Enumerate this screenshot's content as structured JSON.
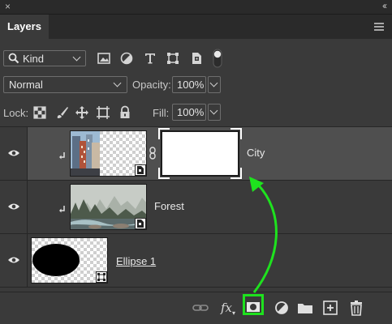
{
  "window": {
    "close_glyph": "×",
    "collapse_glyph": "‹‹"
  },
  "panel": {
    "tab_label": "Layers",
    "menu_icon": "panel-menu-icon"
  },
  "filter": {
    "kind_label": "Kind",
    "icons": [
      "image-filter-icon",
      "adjustment-filter-icon",
      "type-filter-icon",
      "shape-filter-icon",
      "smart-object-filter-icon",
      "filter-toggle-icon"
    ]
  },
  "blend": {
    "mode": "Normal",
    "opacity_label": "Opacity:",
    "opacity_value": "100%"
  },
  "lock": {
    "label": "Lock:",
    "icons": [
      "lock-transparent-pixels-icon",
      "lock-image-pixels-icon",
      "lock-position-icon",
      "lock-artboard-icon",
      "lock-all-icon"
    ],
    "fill_label": "Fill:",
    "fill_value": "100%"
  },
  "layers": [
    {
      "name": "City",
      "selected": true,
      "clipped": true,
      "has_mask": true,
      "type": "smart-object"
    },
    {
      "name": "Forest",
      "selected": false,
      "clipped": true,
      "has_mask": false,
      "type": "smart-object"
    },
    {
      "name": "Ellipse 1",
      "selected": false,
      "clipped": false,
      "has_mask": false,
      "type": "shape"
    }
  ],
  "bottom_bar": {
    "icons": [
      "link-layers-icon",
      "fx-icon",
      "add-layer-mask-icon",
      "new-adjustment-layer-icon",
      "new-group-icon",
      "new-layer-icon",
      "delete-layer-icon"
    ],
    "fx_label": "fx",
    "highlighted": "add-layer-mask-icon"
  },
  "colors": {
    "highlight": "#1ee21e",
    "panel_bg": "#3a3a3a",
    "selected_row": "#4f4f4f"
  }
}
